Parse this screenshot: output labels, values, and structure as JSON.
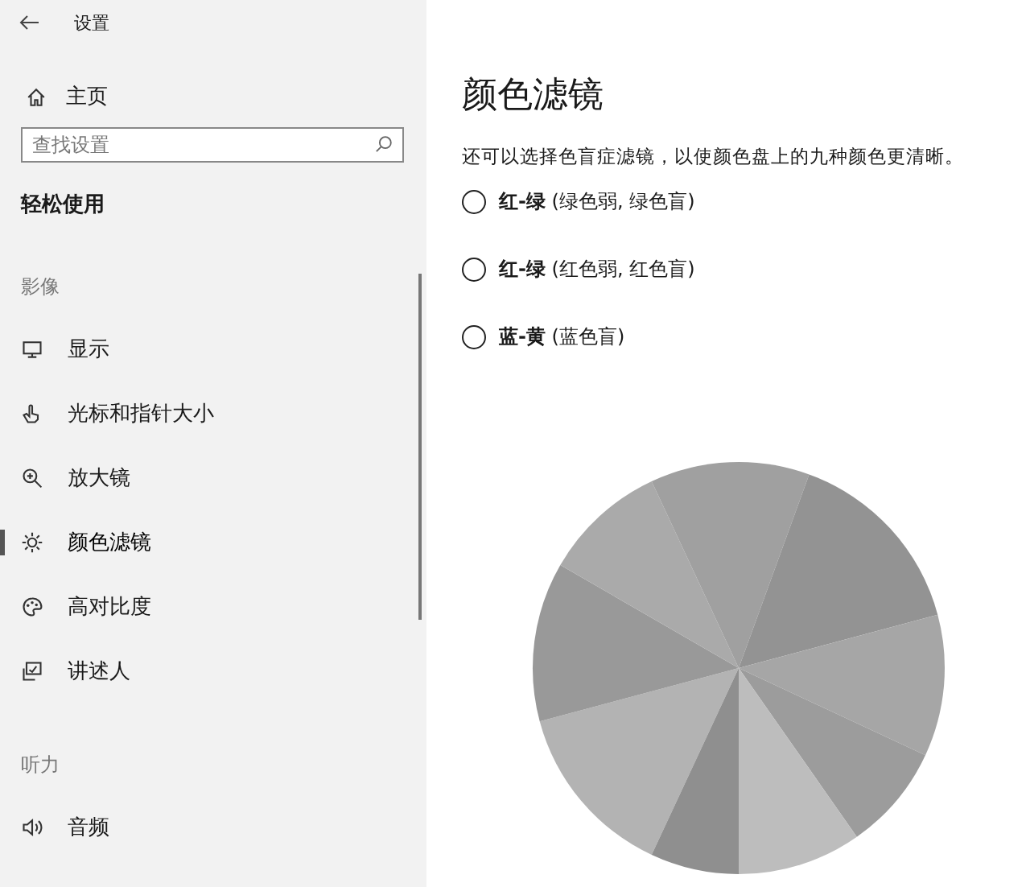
{
  "window": {
    "title": "设置"
  },
  "sidebar": {
    "home": "主页",
    "search": {
      "placeholder": "查找设置"
    },
    "category": "轻松使用",
    "groups": [
      {
        "heading": "影像",
        "items": [
          {
            "label": "显示",
            "selected": false
          },
          {
            "label": "光标和指针大小",
            "selected": false
          },
          {
            "label": "放大镜",
            "selected": false
          },
          {
            "label": "颜色滤镜",
            "selected": true
          },
          {
            "label": "高对比度",
            "selected": false
          },
          {
            "label": "讲述人",
            "selected": false
          }
        ]
      },
      {
        "heading": "听力",
        "items": [
          {
            "label": "音频",
            "selected": false
          }
        ]
      }
    ]
  },
  "content": {
    "title": "颜色滤镜",
    "description": "还可以选择色盲症滤镜，以使颜色盘上的九种颜色更清晰。",
    "filters": [
      {
        "label": "**红-绿** (绿色弱, 绿色盲)",
        "selected": false
      },
      {
        "label": "**红-绿** (红色弱, 红色盲)",
        "selected": false
      },
      {
        "label": "**蓝-黄** (蓝色盲)",
        "selected": false
      }
    ]
  }
}
